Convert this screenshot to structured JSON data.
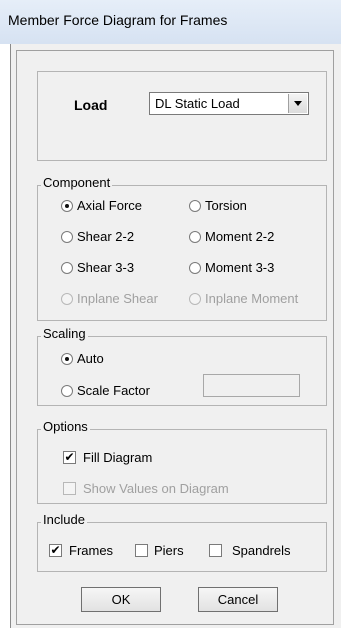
{
  "window": {
    "title": "Member Force Diagram for Frames"
  },
  "load": {
    "label": "Load",
    "selected": "DL Static Load"
  },
  "component": {
    "legend": "Component",
    "options": [
      {
        "label": "Axial Force",
        "selected": true,
        "enabled": true
      },
      {
        "label": "Torsion",
        "selected": false,
        "enabled": true
      },
      {
        "label": "Shear 2-2",
        "selected": false,
        "enabled": true
      },
      {
        "label": "Moment 2-2",
        "selected": false,
        "enabled": true
      },
      {
        "label": "Shear 3-3",
        "selected": false,
        "enabled": true
      },
      {
        "label": "Moment 3-3",
        "selected": false,
        "enabled": true
      },
      {
        "label": "Inplane Shear",
        "selected": false,
        "enabled": false
      },
      {
        "label": "Inplane Moment",
        "selected": false,
        "enabled": false
      }
    ]
  },
  "scaling": {
    "legend": "Scaling",
    "options": [
      {
        "label": "Auto",
        "selected": true
      },
      {
        "label": "Scale Factor",
        "selected": false
      }
    ],
    "scale_factor_value": ""
  },
  "options": {
    "legend": "Options",
    "fill_diagram": {
      "label": "Fill Diagram",
      "checked": true
    },
    "show_values": {
      "label": "Show Values on Diagram",
      "checked": false,
      "enabled": false
    }
  },
  "include": {
    "legend": "Include",
    "frames": {
      "label": "Frames",
      "checked": true
    },
    "piers": {
      "label": "Piers",
      "checked": false
    },
    "spandrels": {
      "label": "Spandrels",
      "checked": false
    }
  },
  "buttons": {
    "ok": "OK",
    "cancel": "Cancel"
  }
}
